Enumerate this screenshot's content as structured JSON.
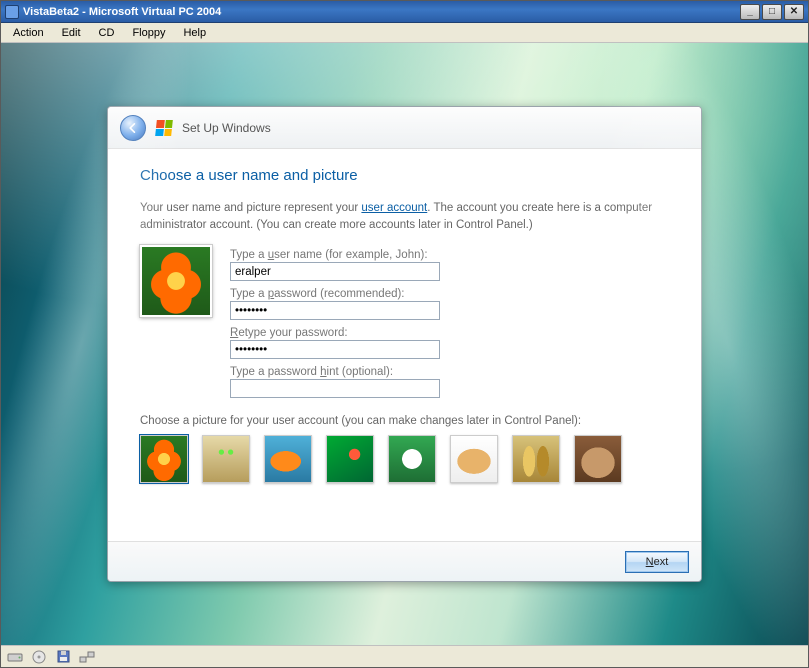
{
  "vpc": {
    "title": "VistaBeta2 - Microsoft Virtual PC 2004",
    "menu": {
      "action": "Action",
      "edit": "Edit",
      "cd": "CD",
      "floppy": "Floppy",
      "help": "Help"
    }
  },
  "oobe": {
    "headerText": "Set Up Windows",
    "heading": "Choose a user name and picture",
    "introPrefix": "Your user name and picture represent your ",
    "introLink": "user account",
    "introSuffix": ". The account you create here is a computer administrator account. (You can create more accounts later in Control Panel.)",
    "fields": {
      "usernameLabel": "Type a user name (for example, John):",
      "usernameValue": "eralper",
      "passwordLabel": "Type a password (recommended):",
      "passwordValue": "********",
      "retypeLabel": "Retype your password:",
      "retypeValue": "********",
      "hintLabel": "Type a password hint (optional):",
      "hintValue": ""
    },
    "pickerLabel": "Choose a picture for your user account (you can make changes later in Control Panel):",
    "pictures": [
      "flower",
      "robot",
      "fish",
      "nature",
      "soccer-ball",
      "dog",
      "chess",
      "cat"
    ],
    "selectedPicture": "flower",
    "nextLabel": "Next"
  }
}
